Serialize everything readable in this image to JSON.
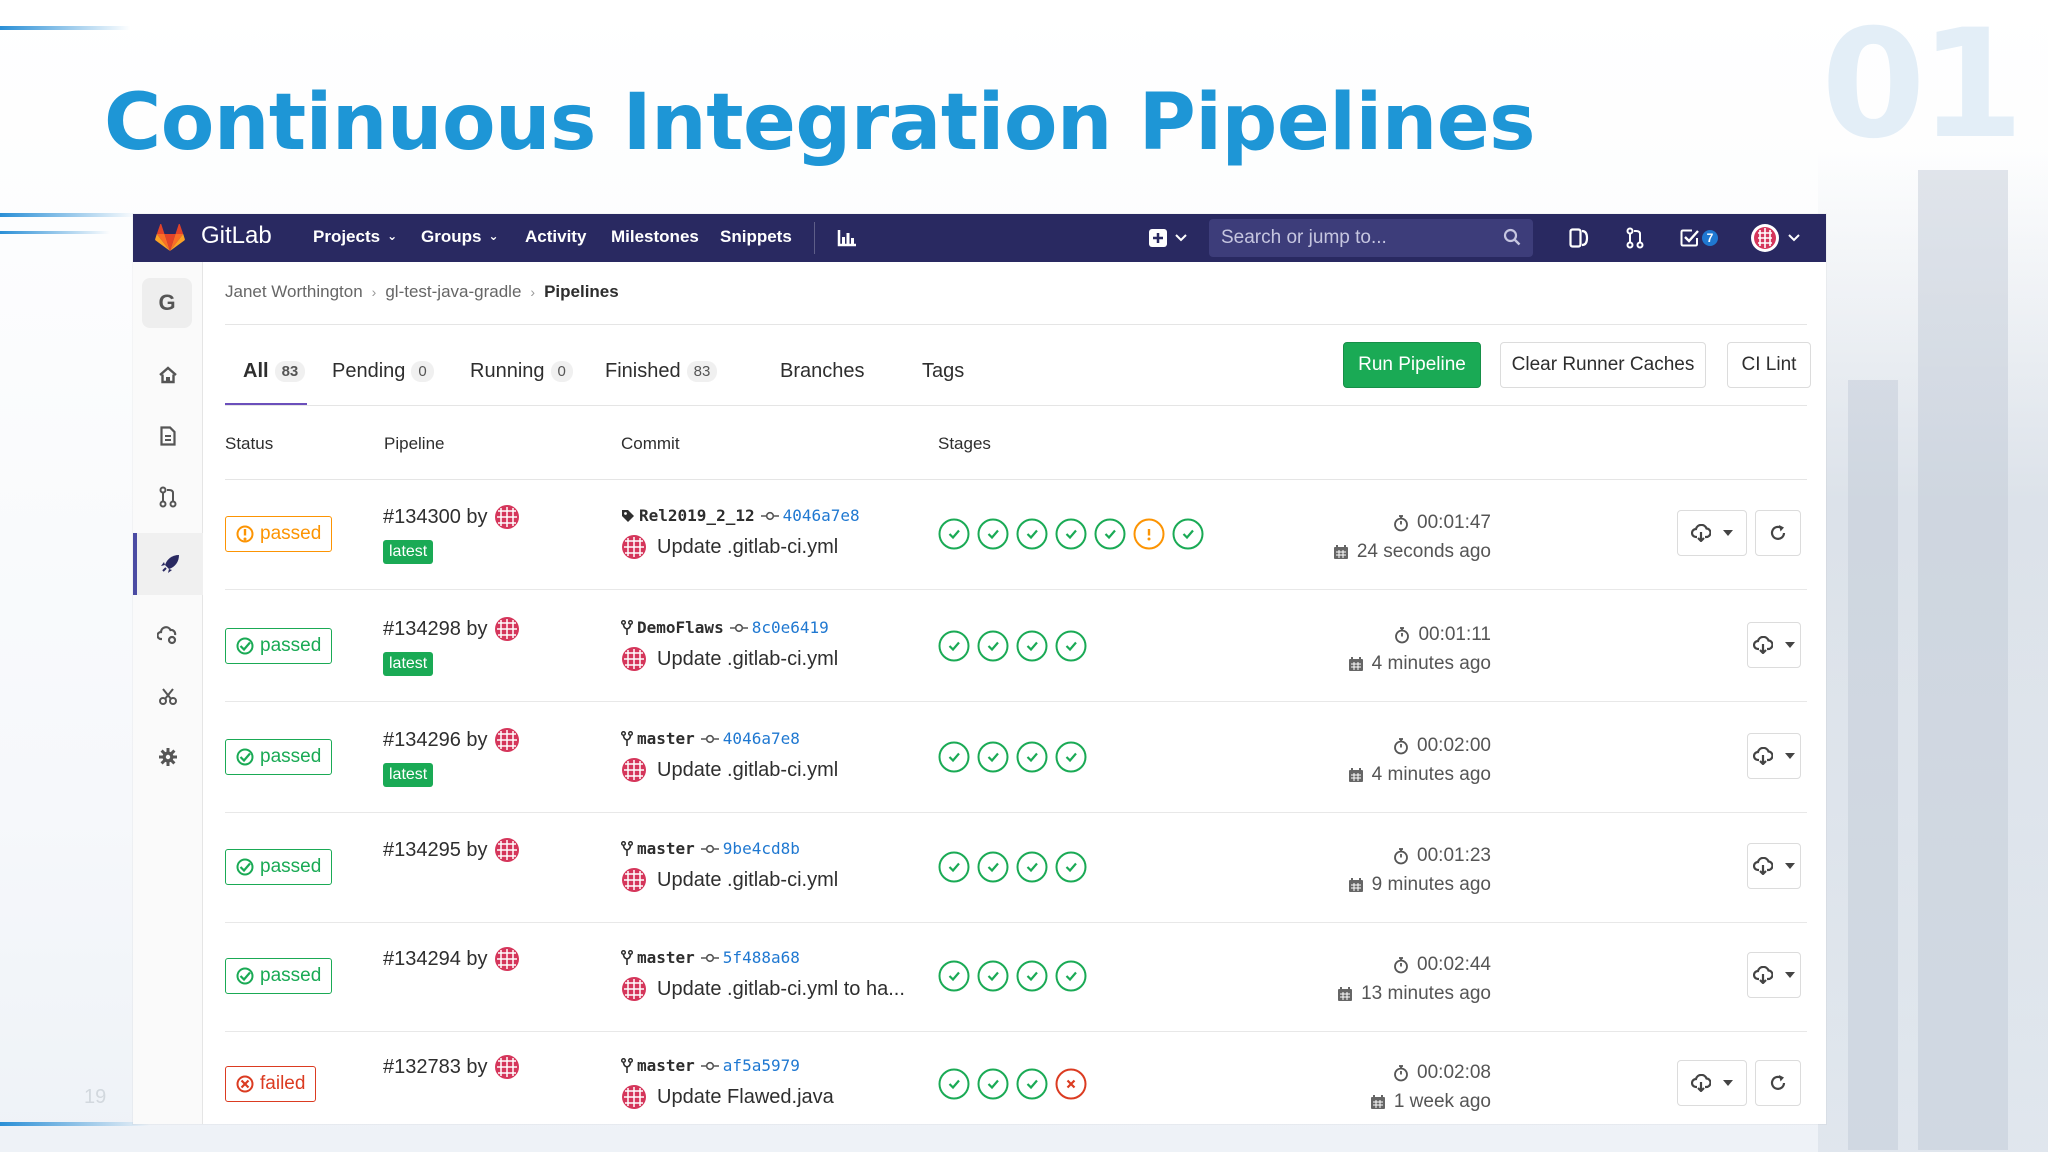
{
  "slide": {
    "title": "Continuous Integration Pipelines",
    "section_number": "01",
    "page_number": "19",
    "title_color": "#1e96d6"
  },
  "navbar": {
    "brand": "GitLab",
    "bg_color": "#292961",
    "items": [
      {
        "label": "Projects",
        "dropdown": true
      },
      {
        "label": "Groups",
        "dropdown": true
      },
      {
        "label": "Activity",
        "dropdown": false
      },
      {
        "label": "Milestones",
        "dropdown": false
      },
      {
        "label": "Snippets",
        "dropdown": false
      }
    ],
    "search_placeholder": "Search or jump to...",
    "todo_count": "7"
  },
  "sidebar": {
    "project_initial": "G",
    "items": [
      {
        "icon": "home-icon"
      },
      {
        "icon": "issues-icon"
      },
      {
        "icon": "merge-request-icon"
      },
      {
        "icon": "rocket-icon",
        "active": true
      },
      {
        "icon": "operations-icon"
      },
      {
        "icon": "snippets-scissors-icon"
      },
      {
        "icon": "settings-gear-icon"
      }
    ]
  },
  "breadcrumb": {
    "items": [
      "Janet Worthington",
      "gl-test-java-gradle",
      "Pipelines"
    ]
  },
  "tabs": [
    {
      "label": "All",
      "count": "83",
      "active": true
    },
    {
      "label": "Pending",
      "count": "0"
    },
    {
      "label": "Running",
      "count": "0"
    },
    {
      "label": "Finished",
      "count": "83"
    },
    {
      "label": "Branches",
      "count": null
    },
    {
      "label": "Tags",
      "count": null
    }
  ],
  "buttons": {
    "run_pipeline": "Run Pipeline",
    "clear_caches": "Clear Runner Caches",
    "ci_lint": "CI Lint"
  },
  "table": {
    "headers": {
      "status": "Status",
      "pipeline": "Pipeline",
      "commit": "Commit",
      "stages": "Stages"
    },
    "rows": [
      {
        "status": "passed",
        "status_kind": "warning",
        "pipeline": "#134300 by",
        "latest": "latest",
        "ref_type": "tag",
        "ref": "Rel2019_2_12",
        "sha": "4046a7e8",
        "message": "Update .gitlab-ci.yml",
        "stages": [
          "success",
          "success",
          "success",
          "success",
          "success",
          "warning",
          "success"
        ],
        "duration": "00:01:47",
        "finished": "24 seconds ago",
        "retry": true
      },
      {
        "status": "passed",
        "status_kind": "success",
        "pipeline": "#134298 by",
        "latest": "latest",
        "ref_type": "branch",
        "ref": "DemoFlaws",
        "sha": "8c0e6419",
        "message": "Update .gitlab-ci.yml",
        "stages": [
          "success",
          "success",
          "success",
          "success"
        ],
        "duration": "00:01:11",
        "finished": "4 minutes ago",
        "retry": false
      },
      {
        "status": "passed",
        "status_kind": "success",
        "pipeline": "#134296 by",
        "latest": "latest",
        "ref_type": "branch",
        "ref": "master",
        "sha": "4046a7e8",
        "message": "Update .gitlab-ci.yml",
        "stages": [
          "success",
          "success",
          "success",
          "success"
        ],
        "duration": "00:02:00",
        "finished": "4 minutes ago",
        "retry": false
      },
      {
        "status": "passed",
        "status_kind": "success",
        "pipeline": "#134295 by",
        "latest": null,
        "ref_type": "branch",
        "ref": "master",
        "sha": "9be4cd8b",
        "message": "Update .gitlab-ci.yml",
        "stages": [
          "success",
          "success",
          "success",
          "success"
        ],
        "duration": "00:01:23",
        "finished": "9 minutes ago",
        "retry": false
      },
      {
        "status": "passed",
        "status_kind": "success",
        "pipeline": "#134294 by",
        "latest": null,
        "ref_type": "branch",
        "ref": "master",
        "sha": "5f488a68",
        "message": "Update .gitlab-ci.yml to ha...",
        "stages": [
          "success",
          "success",
          "success",
          "success"
        ],
        "duration": "00:02:44",
        "finished": "13 minutes ago",
        "retry": false
      },
      {
        "status": "failed",
        "status_kind": "failed",
        "pipeline": "#132783 by",
        "latest": null,
        "ref_type": "branch",
        "ref": "master",
        "sha": "af5a5979",
        "message": "Update Flawed.java",
        "stages": [
          "success",
          "success",
          "success",
          "failed"
        ],
        "duration": "00:02:08",
        "finished": "1 week ago",
        "retry": true
      }
    ]
  },
  "colors": {
    "success": "#1aaa55",
    "warning": "#fc9403",
    "failed": "#db3b21",
    "link": "#1f78d1",
    "tab_active": "#6b4fbb"
  }
}
